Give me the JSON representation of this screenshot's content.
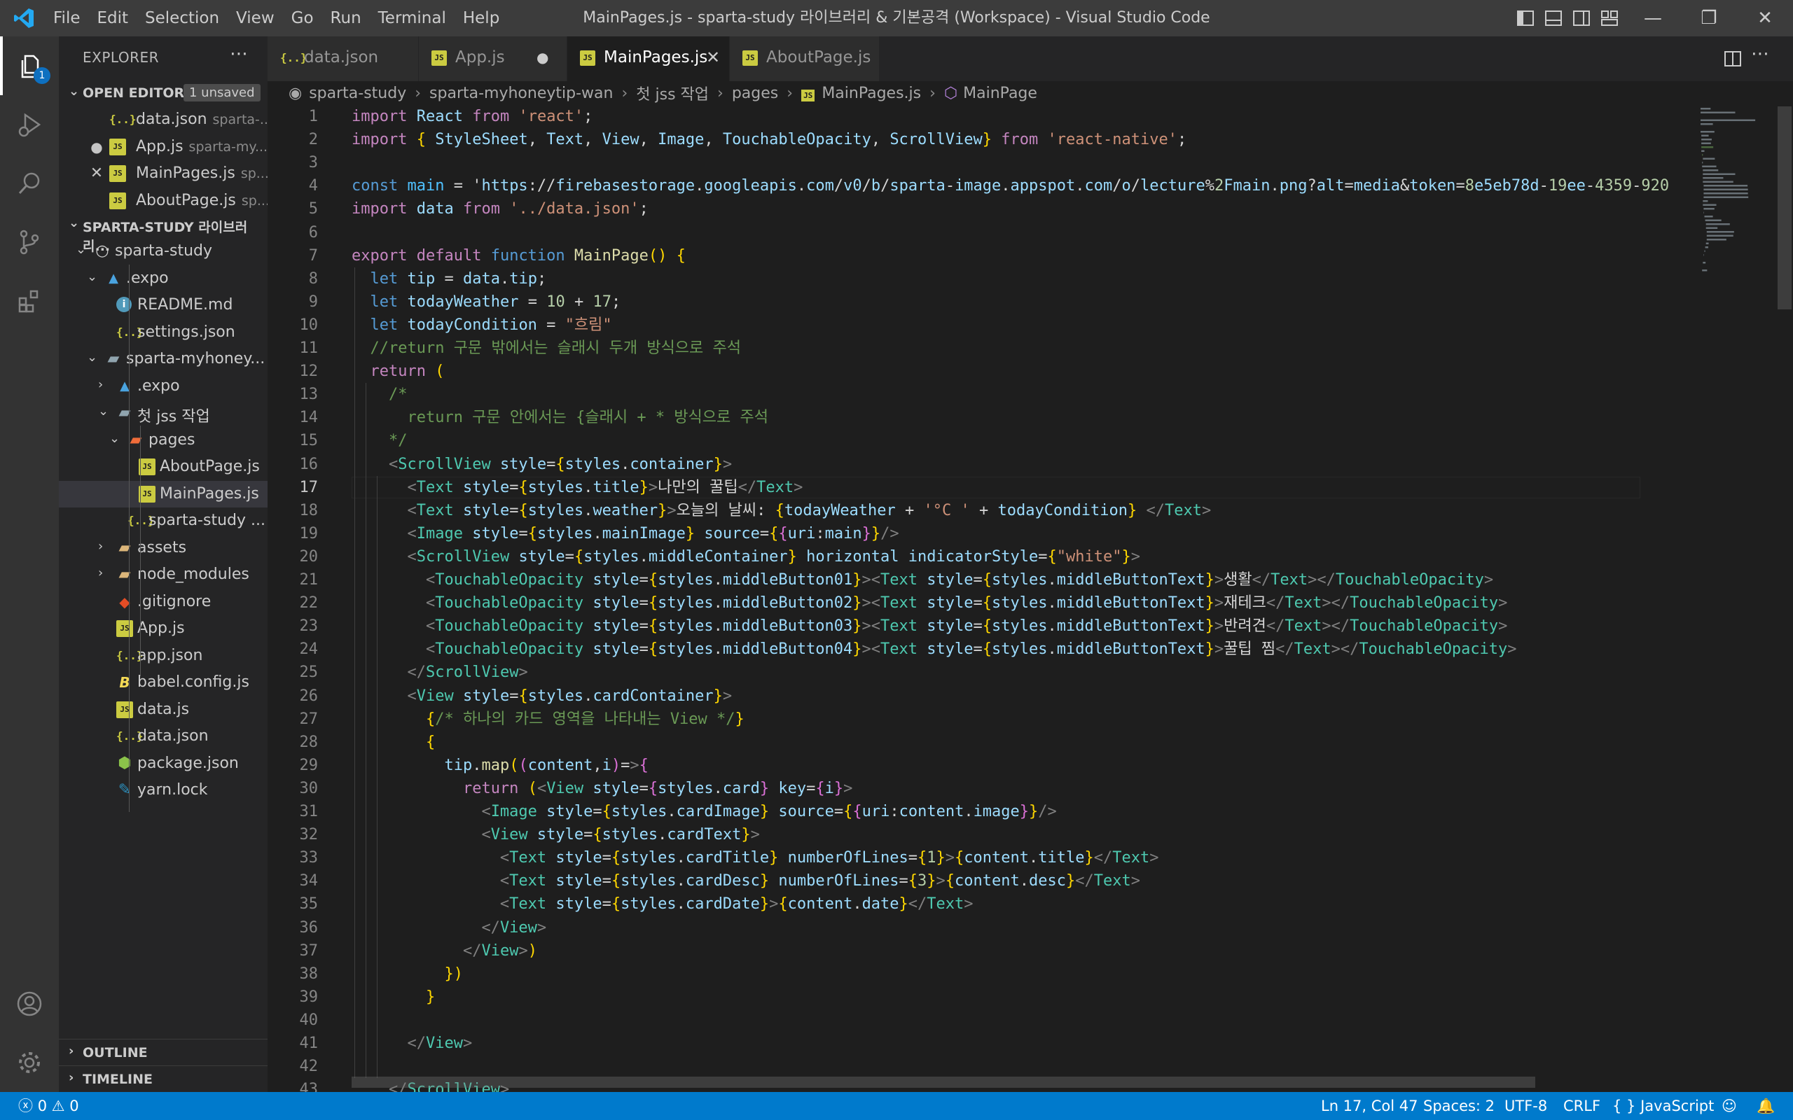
{
  "menu": [
    "File",
    "Edit",
    "Selection",
    "View",
    "Go",
    "Run",
    "Terminal",
    "Help"
  ],
  "window_title": "MainPages.js - sparta-study 라이브러리 & 기본공격 (Workspace) - Visual Studio Code",
  "activity": {
    "explorer_badge": "1"
  },
  "sidebar": {
    "title": "EXPLORER",
    "open_editors_label": "OPEN EDITORS",
    "unsaved_label": "1 unsaved",
    "open_editors": [
      {
        "name": "data.json",
        "path": "sparta-...",
        "icon": "json-icon",
        "marker": ""
      },
      {
        "name": "App.js",
        "path": "sparta-my...",
        "icon": "js-icon",
        "marker": "dot"
      },
      {
        "name": "MainPages.js",
        "path": "sp...",
        "icon": "js-icon",
        "marker": "close"
      },
      {
        "name": "AboutPage.js",
        "path": "sp...",
        "icon": "js-icon",
        "marker": ""
      }
    ],
    "workspace_label": "SPARTA-STUDY 라이브러리...",
    "tree": [
      {
        "name": "sparta-study",
        "depth": 1,
        "icon": "folder-root-icon",
        "twisty": "open"
      },
      {
        "name": ".expo",
        "depth": 2,
        "icon": "expo-folder-icon",
        "twisty": "open"
      },
      {
        "name": "README.md",
        "depth": 3,
        "icon": "info-icon",
        "twisty": ""
      },
      {
        "name": "settings.json",
        "depth": 3,
        "icon": "json-icon",
        "twisty": ""
      },
      {
        "name": "sparta-myhoney...",
        "depth": 2,
        "icon": "folder-open-icon",
        "twisty": "open"
      },
      {
        "name": ".expo",
        "depth": 3,
        "icon": "expo-folder-icon",
        "twisty": "closed"
      },
      {
        "name": "첫 jss 작업",
        "depth": 3,
        "icon": "folder-open-icon",
        "twisty": "open"
      },
      {
        "name": "pages",
        "depth": 4,
        "icon": "folder-pages-icon",
        "twisty": "open"
      },
      {
        "name": "AboutPage.js",
        "depth": 5,
        "icon": "js-icon",
        "twisty": ""
      },
      {
        "name": "MainPages.js",
        "depth": 5,
        "icon": "js-icon",
        "twisty": ""
      },
      {
        "name": "sparta-study ...",
        "depth": 4,
        "icon": "json-icon",
        "twisty": ""
      },
      {
        "name": "assets",
        "depth": 3,
        "icon": "folder-icon",
        "twisty": "closed"
      },
      {
        "name": "node_modules",
        "depth": 3,
        "icon": "folder-icon",
        "twisty": "closed"
      },
      {
        "name": ".gitignore",
        "depth": 3,
        "icon": "git-icon",
        "twisty": ""
      },
      {
        "name": "App.js",
        "depth": 3,
        "icon": "js-icon",
        "twisty": ""
      },
      {
        "name": "app.json",
        "depth": 3,
        "icon": "json-icon",
        "twisty": ""
      },
      {
        "name": "babel.config.js",
        "depth": 3,
        "icon": "babel-icon",
        "twisty": ""
      },
      {
        "name": "data.js",
        "depth": 3,
        "icon": "js-icon",
        "twisty": ""
      },
      {
        "name": "data.json",
        "depth": 3,
        "icon": "json-icon",
        "twisty": ""
      },
      {
        "name": "package.json",
        "depth": 3,
        "icon": "npm-icon",
        "twisty": ""
      },
      {
        "name": "yarn.lock",
        "depth": 3,
        "icon": "yarn-icon",
        "twisty": ""
      }
    ],
    "outline_label": "OUTLINE",
    "timeline_label": "TIMELINE"
  },
  "tabs": [
    {
      "name": "data.json",
      "icon": "json-icon",
      "state": ""
    },
    {
      "name": "App.js",
      "icon": "js-icon",
      "state": "dirty"
    },
    {
      "name": "MainPages.js",
      "icon": "js-icon",
      "state": "active"
    },
    {
      "name": "AboutPage.js",
      "icon": "js-icon",
      "state": ""
    }
  ],
  "breadcrumb": [
    "sparta-study",
    "sparta-myhoneytip-wan",
    "첫 jss 작업",
    "pages",
    "MainPages.js",
    "MainPage"
  ],
  "editor": {
    "current_line": 17,
    "first_line": 1,
    "lines": [
      "import React from 'react';",
      "import { StyleSheet, Text, View, Image, TouchableOpacity, ScrollView} from 'react-native';",
      "",
      "const main = 'https://firebasestorage.googleapis.com/v0/b/sparta-image.appspot.com/o/lecture%2Fmain.png?alt=media&token=8e5eb78d-19ee-4359-920",
      "import data from '../data.json';",
      "",
      "export default function MainPage() {",
      "  let tip = data.tip;",
      "  let todayWeather = 10 + 17;",
      "  let todayCondition = \"흐림\"",
      "  //return 구문 밖에서는 슬래시 두개 방식으로 주석",
      "  return (",
      "    /*",
      "      return 구문 안에서는 {슬래시 + * 방식으로 주석",
      "    */",
      "    <ScrollView style={styles.container}>",
      "      <Text style={styles.title}>나만의 꿀팁</Text>",
      "      <Text style={styles.weather}>오늘의 날씨: {todayWeather + '°C ' + todayCondition} </Text>",
      "      <Image style={styles.mainImage} source={{uri:main}}/>",
      "      <ScrollView style={styles.middleContainer} horizontal indicatorStyle={\"white\"}>",
      "        <TouchableOpacity style={styles.middleButton01}><Text style={styles.middleButtonText}>생활</Text></TouchableOpacity>",
      "        <TouchableOpacity style={styles.middleButton02}><Text style={styles.middleButtonText}>재테크</Text></TouchableOpacity>",
      "        <TouchableOpacity style={styles.middleButton03}><Text style={styles.middleButtonText}>반려견</Text></TouchableOpacity>",
      "        <TouchableOpacity style={styles.middleButton04}><Text style={styles.middleButtonText}>꿀팁 찜</Text></TouchableOpacity>",
      "      </ScrollView>",
      "      <View style={styles.cardContainer}>",
      "        {/* 하나의 카드 영역을 나타내는 View */}",
      "        {",
      "          tip.map((content,i)=>{",
      "            return (<View style={styles.card} key={i}>",
      "              <Image style={styles.cardImage} source={{uri:content.image}}/>",
      "              <View style={styles.cardText}>",
      "                <Text style={styles.cardTitle} numberOfLines={1}>{content.title}</Text>",
      "                <Text style={styles.cardDesc} numberOfLines={3}>{content.desc}</Text>",
      "                <Text style={styles.cardDate}>{content.date}</Text>",
      "              </View>",
      "            </View>)",
      "          })",
      "        }",
      "",
      "      </View>",
      "",
      "    </ScrollView>"
    ]
  },
  "status": {
    "errors": "0",
    "warnings": "0",
    "position": "Ln 17, Col 47",
    "spaces": "Spaces: 2",
    "encoding": "UTF-8",
    "eol": "CRLF",
    "language": "JavaScript"
  },
  "colors": {
    "accent": "#007acc",
    "titlebar": "#3c3c3c",
    "sidebar": "#252526",
    "editor": "#1e1e1e",
    "activitybar": "#333333"
  }
}
